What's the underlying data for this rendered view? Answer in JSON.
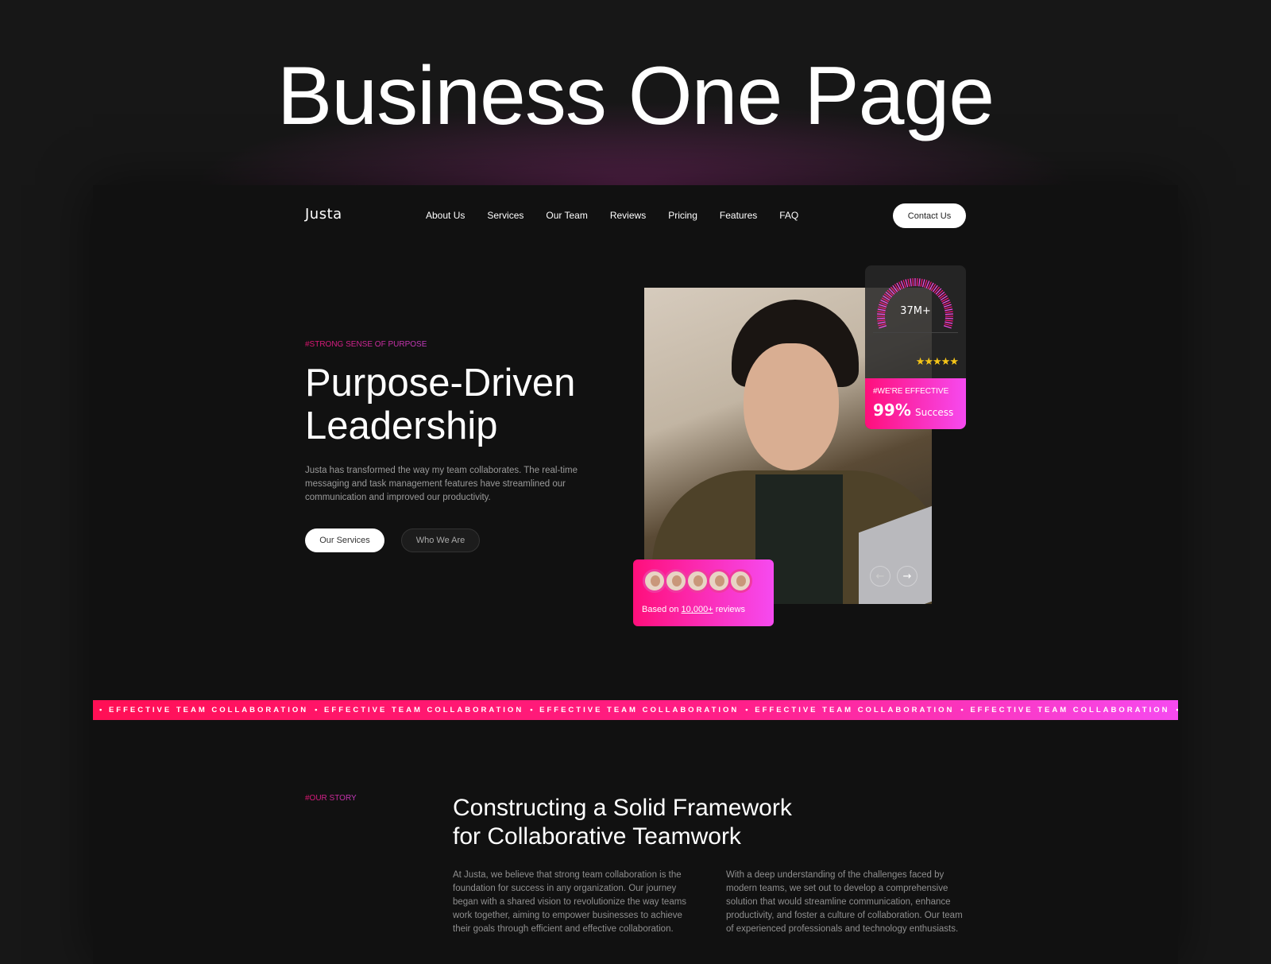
{
  "page_title": "Business One Page",
  "nav": {
    "logo": "Justa",
    "items": [
      "About Us",
      "Services",
      "Our Team",
      "Reviews",
      "Pricing",
      "Features",
      "FAQ"
    ],
    "contact": "Contact Us"
  },
  "hero": {
    "tag": "#STRONG SENSE OF PURPOSE",
    "title_line1": "Purpose-Driven",
    "title_line2": "Leadership",
    "body": "Justa has transformed the way my team collaborates. The real-time messaging and task management features have streamlined our communication and improved our productivity.",
    "btn_primary": "Our Services",
    "btn_secondary": "Who We Are"
  },
  "stats": {
    "gauge_value": "37M+",
    "stars": 5,
    "tag": "#WE'RE EFFECTIVE",
    "percent": "99%",
    "percent_label": "Success"
  },
  "reviews": {
    "prefix": "Based on",
    "count": "10,000+",
    "suffix": "reviews"
  },
  "carousel": {
    "prev": "←",
    "next": "→"
  },
  "band": {
    "text": "• EFFECTIVE TEAM COLLABORATION"
  },
  "story": {
    "tag": "#OUR STORY",
    "title_line1": "Constructing a Solid Framework",
    "title_line2": "for Collaborative Teamwork",
    "col1": "At Justa, we believe that strong team collaboration is the foundation for success in any organization. Our journey began with a shared vision to revolutionize the way teams work together, aiming to empower businesses to achieve their goals through efficient and effective collaboration.",
    "col2": "With a deep understanding of the challenges faced by modern teams, we set out to develop a comprehensive solution that would streamline communication, enhance productivity, and foster a culture of collaboration. Our team of experienced professionals and technology enthusiasts."
  },
  "colors": {
    "accent_start": "#ff0f7b",
    "accent_end": "#f64af0",
    "star": "#f5c518"
  }
}
